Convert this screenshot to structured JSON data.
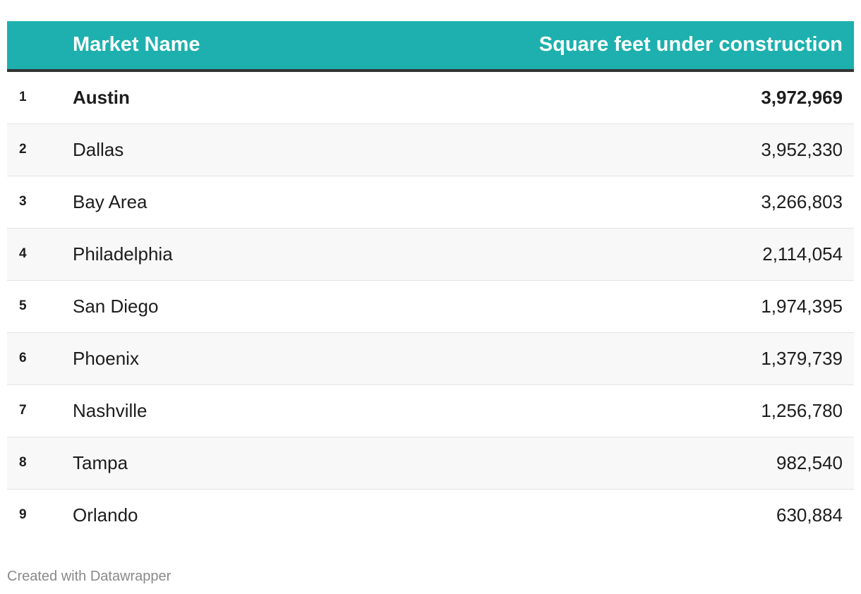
{
  "chart_data": {
    "type": "table",
    "columns": [
      "",
      "Market Name",
      "Square feet under construction"
    ],
    "rows": [
      {
        "rank": "1",
        "name": "Austin",
        "value": "3,972,969",
        "highlight": true
      },
      {
        "rank": "2",
        "name": "Dallas",
        "value": "3,952,330"
      },
      {
        "rank": "3",
        "name": "Bay Area",
        "value": "3,266,803"
      },
      {
        "rank": "4",
        "name": "Philadelphia",
        "value": "2,114,054"
      },
      {
        "rank": "5",
        "name": "San Diego",
        "value": "1,974,395"
      },
      {
        "rank": "6",
        "name": "Phoenix",
        "value": "1,379,739"
      },
      {
        "rank": "7",
        "name": "Nashville",
        "value": "1,256,780"
      },
      {
        "rank": "8",
        "name": "Tampa",
        "value": "982,540"
      },
      {
        "rank": "9",
        "name": "Orlando",
        "value": "630,884"
      }
    ],
    "header_color": "#1db0ae"
  },
  "footer": "Created with Datawrapper"
}
